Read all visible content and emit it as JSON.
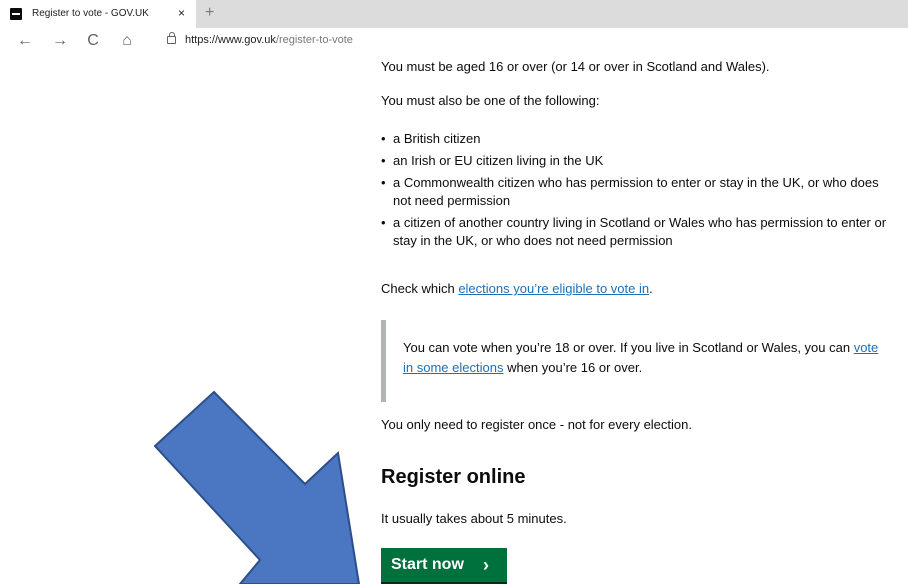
{
  "browser": {
    "tab_title": "Register to vote - GOV.UK",
    "tab_close": "×",
    "new_tab": "+",
    "back": "←",
    "forward": "→",
    "reload": "C",
    "home": "⌂",
    "url_host": "https://www.gov.uk",
    "url_path": "/register-to-vote"
  },
  "page": {
    "age_line": "You must be aged 16 or over (or 14 or over in Scotland and Wales).",
    "also_line": "You must also be one of the following:",
    "bullets": [
      "a British citizen",
      "an Irish or EU citizen living in the UK",
      "a Commonwealth citizen who has permission to enter or stay in the UK, or who does not need permission",
      "a citizen of another country living in Scotland or Wales who has permission to enter or stay in the UK, or who does not need permission"
    ],
    "check_prefix": "Check which ",
    "check_link": "elections you’re eligible to vote in",
    "check_suffix": ".",
    "inset_prefix": "You can vote when you’re 18 or over. If you live in Scotland or Wales, you can ",
    "inset_link": "vote in some elections",
    "inset_suffix": " when you’re 16 or over.",
    "register_once": "You only need to register once - not for every election.",
    "heading": "Register online",
    "takes": "It usually takes about 5 minutes.",
    "start_label": "Start now",
    "start_chevron": "›"
  },
  "colors": {
    "button_green": "#00703c",
    "link_blue": "#1d70b8",
    "arrow_fill": "#4a76c2",
    "arrow_stroke": "#2c4f8c"
  }
}
